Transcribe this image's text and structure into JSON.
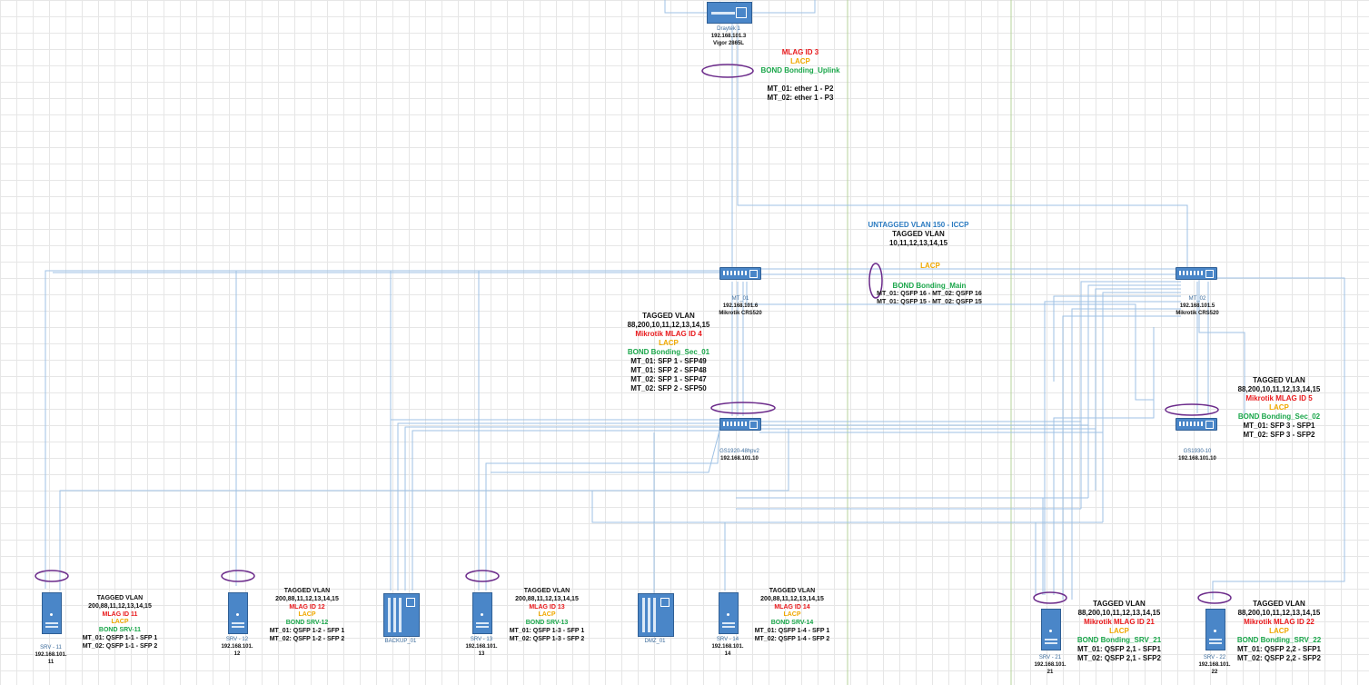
{
  "colors": {
    "wire": "#9fc2e4",
    "bond_ring": "#6b2a8a",
    "vline": "#b7d39b"
  },
  "devices": {
    "draytek": {
      "name": "Draytek 1",
      "ip": "192.168.101.3",
      "model": "Vigor 2865L"
    },
    "mt01": {
      "name": "MT_01",
      "ip": "192.168.101.6",
      "model": "Mikrotik CRS520"
    },
    "mt02": {
      "name": "MT_02",
      "ip": "192.168.101.5",
      "model": "Mikrotik CRS520"
    },
    "gs1920": {
      "name": "GS1920-48hpv2",
      "ip": "192.168.101.10"
    },
    "gs1930": {
      "name": "GS1930-10",
      "ip": "192.168.101.10"
    },
    "srv11": {
      "name": "SRV - 11",
      "ip1": "192.168.101.",
      "ip2": "11"
    },
    "srv12": {
      "name": "SRV - 12",
      "ip1": "192.168.101.",
      "ip2": "12"
    },
    "backup": {
      "name": "BACKUP_01"
    },
    "srv13": {
      "name": "SRV - 13",
      "ip1": "192.168.101.",
      "ip2": "13"
    },
    "dmz": {
      "name": "DMZ_01"
    },
    "srv14": {
      "name": "SRV - 14",
      "ip1": "192.168.101.",
      "ip2": "14"
    },
    "srv21": {
      "name": "SRV - 21",
      "ip1": "192.168.101.",
      "ip2": "21"
    },
    "srv22": {
      "name": "SRV - 22",
      "ip1": "192.168.101.",
      "ip2": "22"
    }
  },
  "notes": {
    "uplink": {
      "mlag": "MLAG ID 3",
      "lacp": "LACP",
      "bond": "BOND Bonding_Uplink",
      "l1": "MT_01: ether 1 - P2",
      "l2": "MT_02: ether 1 - P3"
    },
    "iccp": {
      "untagged": "UNTAGGED VLAN 150 - ICCP",
      "tagged": "TAGGED VLAN",
      "vlans": "10,11,12,13,14,15",
      "lacp": "LACP",
      "bond": "BOND Bonding_Main",
      "l1": "MT_01: QSFP 16 - MT_02: QSFP 16",
      "l2": "MT_01: QSFP 15 - MT_02: QSFP 15"
    },
    "sec01": {
      "tagged": "TAGGED VLAN",
      "vlans": "88,200,10,11,12,13,14,15",
      "mlag": "Mikrotik MLAG ID 4",
      "lacp": "LACP",
      "bond": "BOND Bonding_Sec_01",
      "l1": "MT_01: SFP 1 - SFP49",
      "l2": "MT_01: SFP 2 - SFP48",
      "l3": "MT_02: SFP 1 - SFP47",
      "l4": "MT_02: SFP 2 - SFP50"
    },
    "sec02": {
      "tagged": "TAGGED VLAN",
      "vlans": "88,200,10,11,12,13,14,15",
      "mlag": "Mikrotik MLAG ID 5",
      "lacp": "LACP",
      "bond": "BOND Bonding_Sec_02",
      "l1": "MT_01: SFP 3 - SFP1",
      "l2": "MT_02: SFP 3 - SFP2"
    },
    "srv11": {
      "tagged": "TAGGED VLAN",
      "vlans": "200,88,11,12,13,14,15",
      "mlag": "MLAG ID 11",
      "lacp": "LACP",
      "bond": "BOND SRV-11",
      "l1": "MT_01: QSFP 1-1 - SFP 1",
      "l2": "MT_02: QSFP 1-1 - SFP 2"
    },
    "srv12": {
      "tagged": "TAGGED VLAN",
      "vlans": "200,88,11,12,13,14,15",
      "mlag": "MLAG ID 12",
      "lacp": "LACP",
      "bond": "BOND SRV-12",
      "l1": "MT_01: QSFP 1-2 - SFP 1",
      "l2": "MT_02: QSFP 1-2 - SFP 2"
    },
    "srv13": {
      "tagged": "TAGGED VLAN",
      "vlans": "200,88,11,12,13,14,15",
      "mlag": "MLAG ID 13",
      "lacp": "LACP",
      "bond": "BOND SRV-13",
      "l1": "MT_01: QSFP 1-3 - SFP 1",
      "l2": "MT_02: QSFP 1-3 - SFP 2"
    },
    "srv14": {
      "tagged": "TAGGED VLAN",
      "vlans": "200,88,11,12,13,14,15",
      "mlag": "MLAG ID 14",
      "lacp": "LACP",
      "bond": "BOND SRV-14",
      "l1": "MT_01: QSFP 1-4 - SFP 1",
      "l2": "MT_02: QSFP 1-4 - SFP 2"
    },
    "srv21": {
      "tagged": "TAGGED VLAN",
      "vlans": "88,200,10,11,12,13,14,15",
      "mlag": "Mikrotik MLAG ID 21",
      "lacp": "LACP",
      "bond": "BOND Bonding_SRV_21",
      "l1": "MT_01: QSFP 2,1 - SFP1",
      "l2": "MT_02: QSFP 2,1 - SFP2"
    },
    "srv22": {
      "tagged": "TAGGED VLAN",
      "vlans": "88,200,10,11,12,13,14,15",
      "mlag": "Mikrotik MLAG ID 22",
      "lacp": "LACP",
      "bond": "BOND Bonding_SRV_22",
      "l1": "MT_01: QSFP 2,2 - SFP1",
      "l2": "MT_02: QSFP 2,2 - SFP2"
    }
  }
}
